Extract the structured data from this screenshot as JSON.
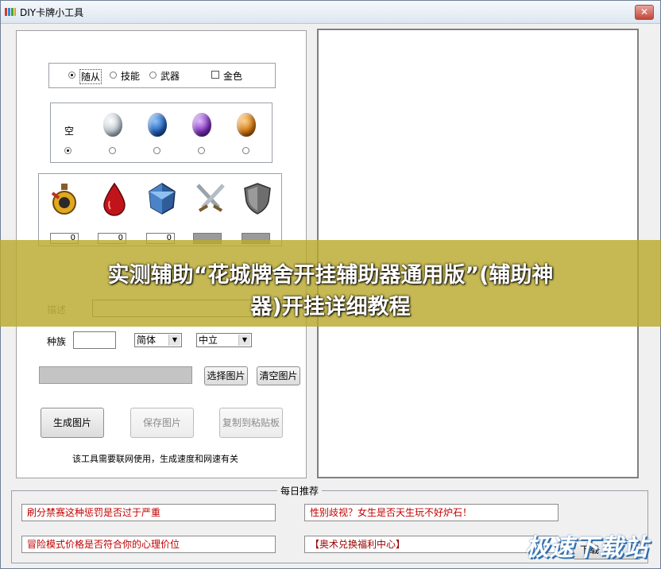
{
  "window": {
    "title": "DIY卡牌小工具",
    "close_glyph": "✕"
  },
  "card_type": {
    "options": [
      "随从",
      "技能",
      "武器"
    ],
    "selected_index": 0,
    "gold_label": "金色",
    "gold_checked": false
  },
  "rarity": {
    "empty_label": "空",
    "selected_index": 0
  },
  "stats": {
    "values": [
      "0",
      "0",
      "0",
      "",
      ""
    ]
  },
  "form": {
    "desc_label": "描述",
    "race_label": "种族",
    "race_value": "",
    "font_select": "简体",
    "align_select": "中立"
  },
  "buttons": {
    "select_image": "选择图片",
    "clear_image": "清空图片",
    "generate": "生成图片",
    "save": "保存图片",
    "copy": "复制到粘贴板"
  },
  "notice": "该工具需要联网使用，生成速度和网速有关",
  "overlay": {
    "line1": "实测辅助“花城牌舍开挂辅助器通用版”(辅助神",
    "line2": "器)开挂详细教程"
  },
  "daily": {
    "title": "每日推荐",
    "items": [
      "刷分禁赛这种惩罚是否过于严重",
      "性别歧视？女生是否天生玩不好炉石！",
      "冒险模式价格是否符合你的心理价位",
      "【奥术兑换福利中心】"
    ]
  },
  "watermark": "极速下载站",
  "partial_button": "下载"
}
